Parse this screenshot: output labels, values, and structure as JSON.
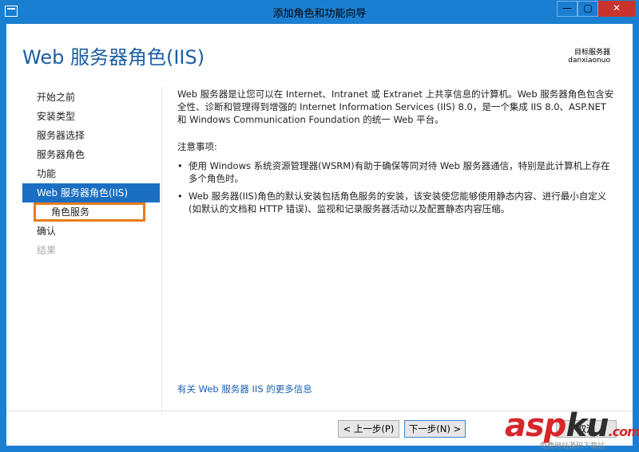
{
  "window": {
    "title": "添加角色和功能向导",
    "minimize_glyph": "—",
    "maximize_glyph": "▢",
    "close_glyph": "✕"
  },
  "header": {
    "title": "Web 服务器角色(IIS)",
    "target_label": "目标服务器",
    "target_server": "danxiaonuo"
  },
  "nav": {
    "items": [
      {
        "label": "开始之前",
        "state": "normal"
      },
      {
        "label": "安装类型",
        "state": "normal"
      },
      {
        "label": "服务器选择",
        "state": "normal"
      },
      {
        "label": "服务器角色",
        "state": "normal"
      },
      {
        "label": "功能",
        "state": "normal"
      },
      {
        "label": "Web 服务器角色(IIS)",
        "state": "selected"
      },
      {
        "label": "角色服务",
        "state": "sub-highlight"
      },
      {
        "label": "确认",
        "state": "normal"
      },
      {
        "label": "结果",
        "state": "disabled"
      }
    ]
  },
  "content": {
    "intro": "Web 服务器是让您可以在 Internet、Intranet 或 Extranet 上共享信息的计算机。Web 服务器角色包含安全性、诊断和管理得到增强的 Internet Information Services (IIS) 8.0，是一个集成 IIS 8.0、ASP.NET 和 Windows Communication Foundation 的统一 Web 平台。",
    "notes_title": "注意事项:",
    "bullets": [
      "使用 Windows 系统资源管理器(WSRM)有助于确保等同对待 Web 服务器通信，特别是此计算机上存在多个角色时。",
      "Web 服务器(IIS)角色的默认安装包括角色服务的安装，该安装使您能够使用静态内容、进行最小自定义(如默认的文档和 HTTP 错误)、监视和记录服务器活动以及配置静态内容压缩。"
    ],
    "bullet_glyph": "•",
    "more_link": "有关 Web 服务器 IIS 的更多信息"
  },
  "footer": {
    "prev_label": "< 上一步(P)",
    "next_label": "下一步(N) >",
    "cancel_label": "取消"
  },
  "watermark": {
    "brand_red": "asp",
    "brand_dark": "ku",
    "suffix": ".com",
    "sub": "免费网站源码下载站"
  },
  "colors": {
    "accent": "#1b7fd1",
    "selected_nav": "#1b6fc2",
    "highlight_box": "#e87b1a",
    "link": "#1a5fb4",
    "close_button": "#c8342b"
  }
}
